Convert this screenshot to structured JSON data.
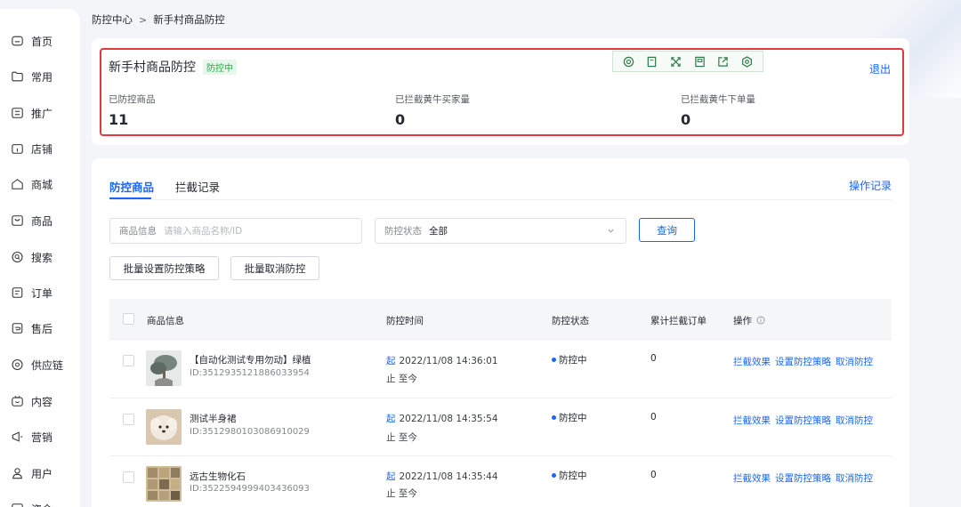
{
  "breadcrumb": {
    "parent": "防控中心",
    "sep": ">",
    "current": "新手村商品防控"
  },
  "sidebar": {
    "items": [
      {
        "label": "首页",
        "icon": "home-icon"
      },
      {
        "label": "常用",
        "icon": "folder-icon"
      },
      {
        "label": "推广",
        "icon": "promotion-icon"
      },
      {
        "label": "店铺",
        "icon": "shop-icon"
      },
      {
        "label": "商城",
        "icon": "mall-icon"
      },
      {
        "label": "商品",
        "icon": "product-icon"
      },
      {
        "label": "搜索",
        "icon": "search-icon"
      },
      {
        "label": "订单",
        "icon": "order-icon"
      },
      {
        "label": "售后",
        "icon": "after-sales-icon"
      },
      {
        "label": "供应链",
        "icon": "supply-chain-icon"
      },
      {
        "label": "内容",
        "icon": "content-icon"
      },
      {
        "label": "营销",
        "icon": "marketing-icon"
      },
      {
        "label": "用户",
        "icon": "user-icon"
      },
      {
        "label": "资金",
        "icon": "funds-icon"
      }
    ]
  },
  "header": {
    "title": "新手村商品防控",
    "badge": "防控中",
    "exit": "退出",
    "stats": [
      {
        "label": "已防控商品",
        "value": "11"
      },
      {
        "label": "已拦截黄牛买家量",
        "value": "0"
      },
      {
        "label": "已拦截黄牛下单量",
        "value": "0"
      }
    ]
  },
  "toolbar": {
    "icons": [
      "zoom-search-icon",
      "page-icon",
      "expand-icon",
      "save-icon",
      "share-icon",
      "settings-icon"
    ]
  },
  "tabs": {
    "active": "防控商品",
    "inactive": "拦截记录",
    "oplog": "操作记录"
  },
  "filters": {
    "product_label": "商品信息",
    "product_placeholder": "请输入商品名称/ID",
    "status_label": "防控状态",
    "status_value": "全部",
    "query": "查询",
    "batch_set": "批量设置防控策略",
    "batch_cancel": "批量取消防控"
  },
  "table": {
    "headers": {
      "product": "商品信息",
      "time": "防控时间",
      "status": "防控状态",
      "orders": "累计拦截订单",
      "ops": "操作"
    },
    "rows": [
      {
        "name": "【自动化测试专用勿动】绿植",
        "id": "ID:3512935121886033954",
        "start_tag": "起",
        "start": "2022/11/08 14:36:01",
        "end_tag": "止",
        "end": "至今",
        "status": "防控中",
        "orders": "0"
      },
      {
        "name": "测试半身裙",
        "id": "ID:3512980103086910029",
        "start_tag": "起",
        "start": "2022/11/08 14:35:54",
        "end_tag": "止",
        "end": "至今",
        "status": "防控中",
        "orders": "0"
      },
      {
        "name": "远古生物化石",
        "id": "ID:3522594999403436093",
        "start_tag": "起",
        "start": "2022/11/08 14:35:44",
        "end_tag": "止",
        "end": "至今",
        "status": "防控中",
        "orders": "0"
      }
    ],
    "actions": [
      "拦截效果",
      "设置防控策略",
      "取消防控"
    ]
  },
  "colors": {
    "accent": "#1966ff",
    "highlight_border": "#e0393e",
    "success": "#26a944"
  }
}
